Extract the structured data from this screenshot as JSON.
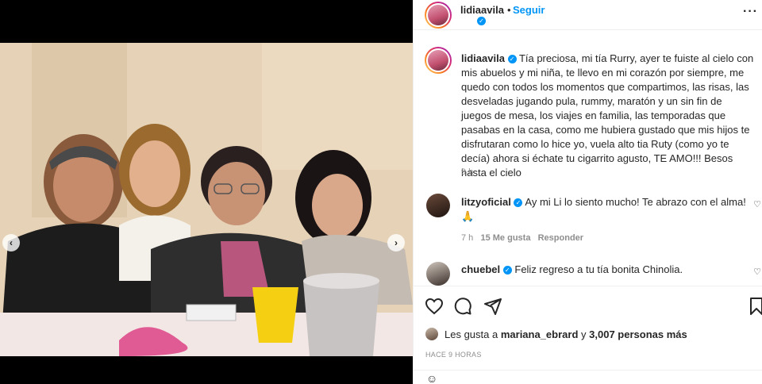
{
  "post": {
    "author": "lidiaavila",
    "follow_label": "Seguir",
    "caption": "Tía preciosa, mi tía Rurry, ayer te fuiste al cielo con mis abuelos y mi niña, te llevo en mi corazón por siempre, me quedo con todos los momentos que compartimos, las risas, las desveladas jugando pula, rummy, maratón y un sin fin de juegos de mesa, los viajes en familia, las temporadas que pasabas en la casa, como me hubiera gustado que mis hijos te disfrutaran como lo hice yo, vuela alto tia Ruty (como yo te decía) ahora si échate tu cigarrito agusto, TE AMO!!! Besos hasta el cielo",
    "caption_time": "9 h"
  },
  "comments": [
    {
      "user": "litzyoficial",
      "text": "Ay mi Li lo siento mucho! Te abrazo con el alma!",
      "emoji": "🙏",
      "time": "7 h",
      "likes": "15 Me gusta",
      "reply": "Responder"
    },
    {
      "user": "chuebel",
      "text": "Feliz regreso a tu tía bonita Chinolia."
    }
  ],
  "likes": {
    "prefix": "Les gusta a",
    "user": "mariana_ebrard",
    "connector": "y",
    "count": "3,007 personas más"
  },
  "time_ago": "HACE 9 HORAS",
  "icons": {
    "like": "heart-icon",
    "comment": "comment-icon",
    "share": "share-icon",
    "save": "bookmark-icon",
    "more": "more-icon",
    "prev": "chevron-left-icon",
    "next": "chevron-right-icon"
  },
  "colors": {
    "accent": "#0095f6",
    "text": "#262626",
    "muted": "#8e8e8e"
  }
}
